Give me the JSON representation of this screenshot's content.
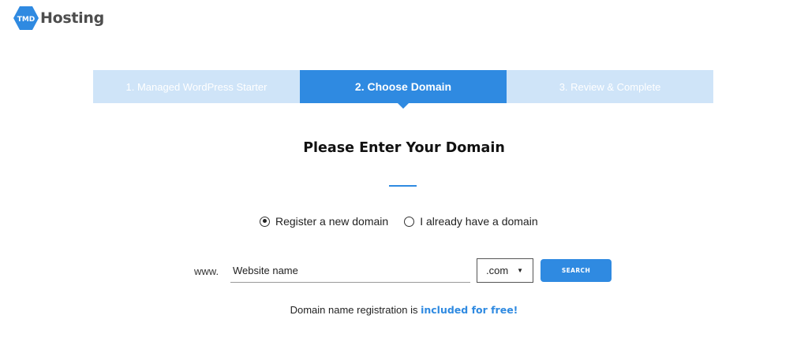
{
  "brand": {
    "logo_mark": "TMD",
    "logo_text": "Hosting",
    "color": "#2f8ae1"
  },
  "steps": [
    {
      "label": "1. Managed WordPress Starter",
      "state": "inactive"
    },
    {
      "label": "2. Choose Domain",
      "state": "active"
    },
    {
      "label": "3. Review & Complete",
      "state": "inactive"
    }
  ],
  "heading": "Please Enter Your Domain",
  "domain_options": [
    {
      "label": "Register a new domain",
      "checked": true
    },
    {
      "label": "I already have a domain",
      "checked": false
    }
  ],
  "search": {
    "prefix": "www.",
    "placeholder": "Website name",
    "tld_selected": ".com",
    "button_label": "SEARCH"
  },
  "note": {
    "text": "Domain name registration is ",
    "highlight": "included for free!"
  },
  "colors": {
    "accent": "#2f8ae1",
    "step_inactive": "#cfe4f8"
  }
}
